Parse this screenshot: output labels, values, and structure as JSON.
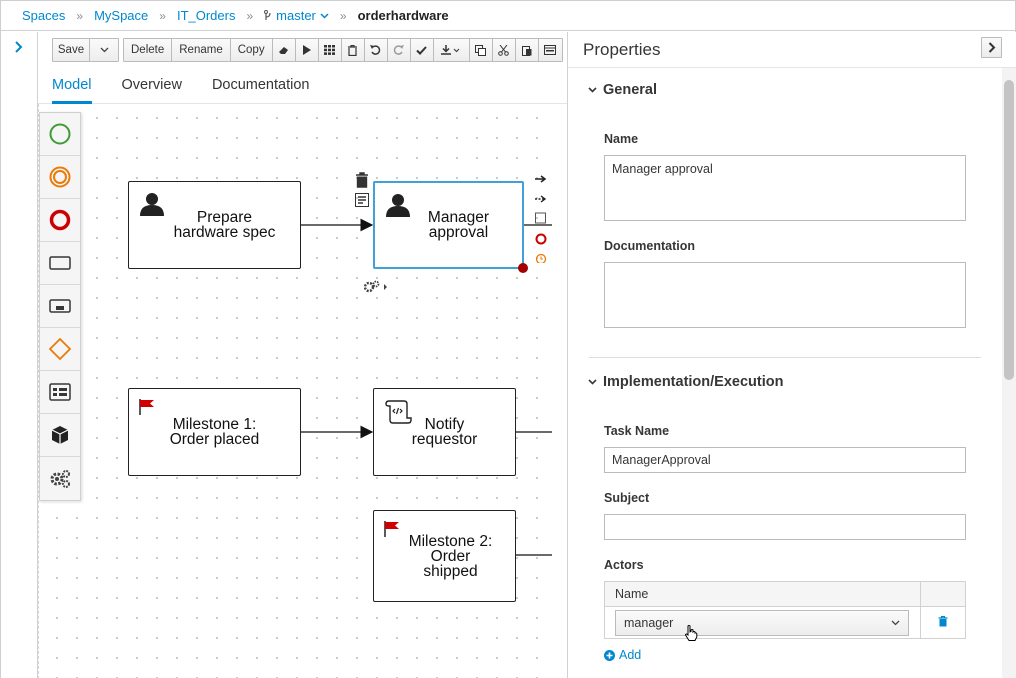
{
  "breadcrumb": {
    "spaces": "Spaces",
    "myspace": "MySpace",
    "project": "IT_Orders",
    "branch": "master",
    "current": "orderhardware"
  },
  "toolbar": {
    "save": "Save",
    "delete": "Delete",
    "rename": "Rename",
    "copy": "Copy"
  },
  "tabs": [
    {
      "label": "Model",
      "active": true
    },
    {
      "label": "Overview",
      "active": false
    },
    {
      "label": "Documentation",
      "active": false
    }
  ],
  "palette": [
    {
      "icon": "start-event-icon",
      "color": "#3f9c35"
    },
    {
      "icon": "intermediate-event-icon",
      "color": "#ec7a08"
    },
    {
      "icon": "end-event-icon",
      "color": "#cc0000"
    },
    {
      "icon": "task-icon",
      "color": "#363636"
    },
    {
      "icon": "subprocess-icon",
      "color": "#363636"
    },
    {
      "icon": "gateway-icon",
      "color": "#ec7a08"
    },
    {
      "icon": "lane-icon",
      "color": "#363636"
    },
    {
      "icon": "custom-task-icon",
      "color": "#363636"
    },
    {
      "icon": "service-tasks-icon",
      "color": "#363636"
    }
  ],
  "nodes": {
    "prepare": "Prepare\nhardware spec",
    "manager": "Manager\napproval",
    "milestone1": "Milestone 1:\nOrder placed",
    "notify": "Notify\nrequestor",
    "milestone2": "Milestone 2:\nOrder\nshipped"
  },
  "properties": {
    "title": "Properties",
    "general_title": "General",
    "name_label": "Name",
    "name_value": "Manager approval",
    "documentation_label": "Documentation",
    "documentation_value": "",
    "impl_title": "Implementation/Execution",
    "task_name_label": "Task Name",
    "task_name_value": "ManagerApproval",
    "subject_label": "Subject",
    "subject_value": "",
    "actors_label": "Actors",
    "actors_col_name": "Name",
    "actor_value": "manager",
    "add_label": "Add"
  }
}
